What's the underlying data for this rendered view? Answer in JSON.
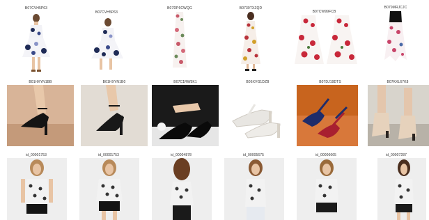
{
  "rows": [
    {
      "items": [
        {
          "id": "B07CVH5P63"
        },
        {
          "id": "B07CVH5P63"
        },
        {
          "id": "B07DP6CWQG"
        },
        {
          "id": "B0739TXZQD"
        },
        {
          "id": "B07CW99FCB"
        },
        {
          "id": "B079MRJCJC"
        }
      ]
    },
    {
      "items": [
        {
          "id": "B01HXYN1BB"
        },
        {
          "id": "B01HXYN1B0"
        },
        {
          "id": "B07C1RW5K1"
        },
        {
          "id": "B06XVG1DZB"
        },
        {
          "id": "B07DJ19DTS"
        },
        {
          "id": "B07KXL67K8"
        }
      ]
    },
    {
      "items": [
        {
          "id": "id_00001753"
        },
        {
          "id": "id_00001753"
        },
        {
          "id": "id_00004878"
        },
        {
          "id": "id_00005675"
        },
        {
          "id": "id_00006665"
        },
        {
          "id": "id_00007287"
        }
      ]
    }
  ]
}
